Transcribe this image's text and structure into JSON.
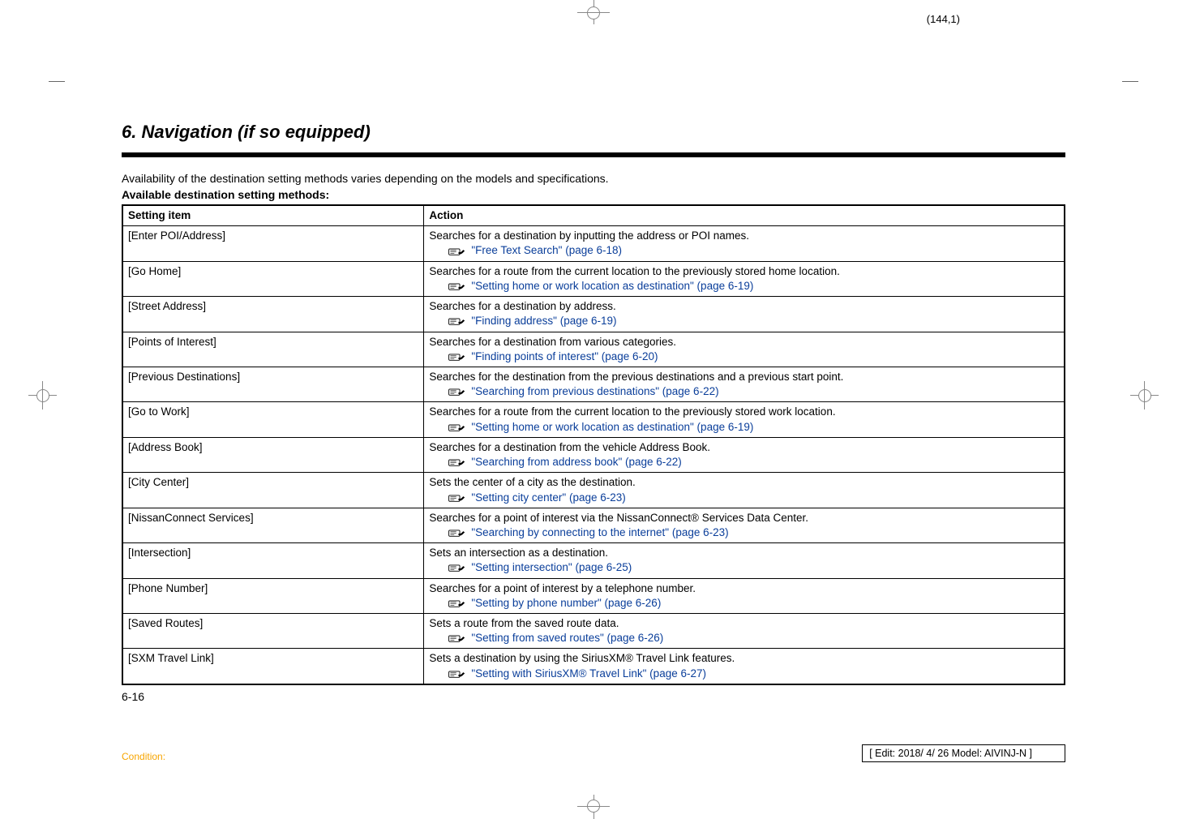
{
  "page_coord": "(144,1)",
  "section_title": "6. Navigation (if so equipped)",
  "intro": "Availability of the destination setting methods varies depending on the models and specifications.",
  "subhead": "Available destination setting methods:",
  "headers": {
    "item": "Setting item",
    "action": "Action"
  },
  "rows": [
    {
      "item": "[Enter POI/Address]",
      "action": "Searches for a destination by inputting the address or POI names.",
      "ref": "\"Free Text Search\" (page 6-18)"
    },
    {
      "item": "[Go Home]",
      "action": "Searches for a route from the current location to the previously stored home location.",
      "ref": "\"Setting home or work location as destination\" (page 6-19)"
    },
    {
      "item": "[Street Address]",
      "action": "Searches for a destination by address.",
      "ref": "\"Finding address\" (page 6-19)"
    },
    {
      "item": "[Points of Interest]",
      "action": "Searches for a destination from various categories.",
      "ref": "\"Finding points of interest\" (page 6-20)"
    },
    {
      "item": "[Previous Destinations]",
      "action": "Searches for the destination from the previous destinations and a previous start point.",
      "ref": "\"Searching from previous destinations\" (page 6-22)"
    },
    {
      "item": "[Go to Work]",
      "action": "Searches for a route from the current location to the previously stored work location.",
      "ref": "\"Setting home or work location as destination\" (page 6-19)"
    },
    {
      "item": "[Address Book]",
      "action": "Searches for a destination from the vehicle Address Book.",
      "ref": "\"Searching from address book\" (page 6-22)"
    },
    {
      "item": "[City Center]",
      "action": "Sets the center of a city as the destination.",
      "ref": "\"Setting city center\" (page 6-23)"
    },
    {
      "item": "[NissanConnect Services]",
      "action": "Searches for a point of interest via the NissanConnect® Services Data Center.",
      "ref": "\"Searching by connecting to the internet\" (page 6-23)"
    },
    {
      "item": "[Intersection]",
      "action": "Sets an intersection as a destination.",
      "ref": "\"Setting intersection\" (page 6-25)"
    },
    {
      "item": "[Phone Number]",
      "action": "Searches for a point of interest by a telephone number.",
      "ref": "\"Setting by phone number\" (page 6-26)"
    },
    {
      "item": "[Saved Routes]",
      "action": "Sets a route from the saved route data.",
      "ref": "\"Setting from saved routes\" (page 6-26)"
    },
    {
      "item": "[SXM Travel Link]",
      "action": "Sets a destination by using the SiriusXM® Travel Link features.",
      "ref": "\"Setting with SiriusXM® Travel Link\" (page 6-27)"
    }
  ],
  "page_number": "6-16",
  "footer": {
    "condition": "Condition:",
    "edit": "Edit: 2018/ 4/ 26    Model:  AIVINJ-N"
  }
}
